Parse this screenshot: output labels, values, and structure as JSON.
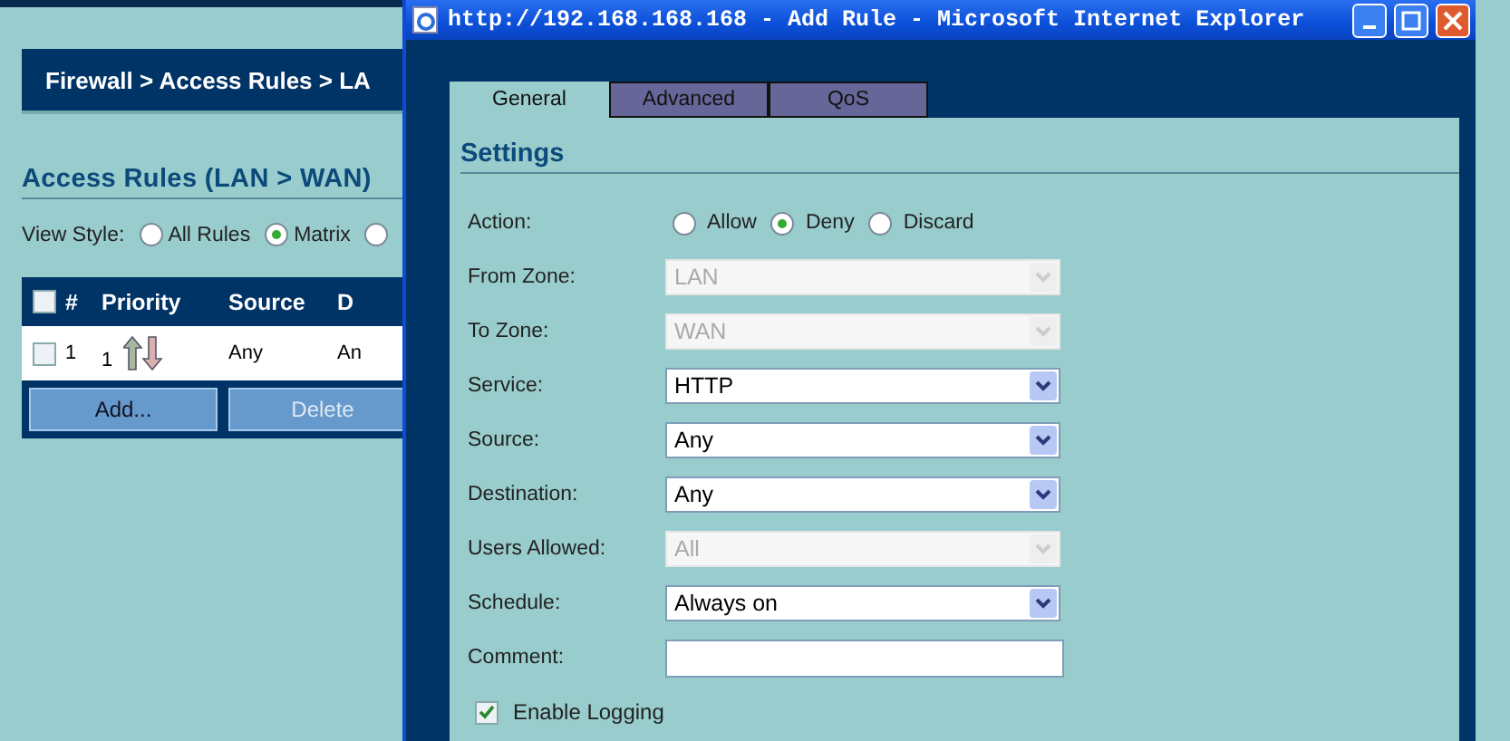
{
  "page": {
    "breadcrumb": "Firewall > Access Rules > LA",
    "heading": "Access Rules (LAN > WAN)",
    "view_style": {
      "label": "View Style:",
      "options": [
        {
          "label": "All Rules",
          "selected": false
        },
        {
          "label": "Matrix",
          "selected": true
        },
        {
          "selected": false
        }
      ]
    },
    "table": {
      "header_checked": false,
      "columns": [
        "#",
        "Priority",
        "Source",
        "D"
      ],
      "rows": [
        {
          "checked": false,
          "number": "1",
          "priority": "1",
          "source": "Any",
          "column_4": "An"
        }
      ],
      "buttons": [
        {
          "label": "Add...",
          "disabled": false
        },
        {
          "label": "Delete",
          "disabled": true
        }
      ]
    }
  },
  "popup": {
    "title": "http://192.168.168.168 - Add Rule - Microsoft Internet Explorer",
    "tabs": [
      {
        "label": "General",
        "selected": true
      },
      {
        "label": "Advanced",
        "selected": false
      },
      {
        "label": "QoS",
        "selected": false
      }
    ],
    "section": "Settings",
    "action": {
      "label": "Action:",
      "options": [
        {
          "label": "Allow",
          "selected": false
        },
        {
          "label": "Deny",
          "selected": true
        },
        {
          "label": "Discard",
          "selected": false
        }
      ]
    },
    "fields": [
      {
        "label": "From Zone:",
        "kind": "select",
        "value": "LAN",
        "disabled": true
      },
      {
        "label": "To Zone:",
        "kind": "select",
        "value": "WAN",
        "disabled": true
      },
      {
        "label": "Service:",
        "kind": "select",
        "value": "HTTP",
        "disabled": false
      },
      {
        "label": "Source:",
        "kind": "select",
        "value": "Any",
        "disabled": false
      },
      {
        "label": "Destination:",
        "kind": "select",
        "value": "Any",
        "disabled": false
      },
      {
        "label": "Users Allowed:",
        "kind": "select",
        "value": "All",
        "disabled": true
      },
      {
        "label": "Schedule:",
        "kind": "select",
        "value": "Always on",
        "disabled": false
      },
      {
        "label": "Comment:",
        "kind": "text"
      }
    ],
    "logging": {
      "label": "Enable Logging",
      "checked": true
    }
  }
}
